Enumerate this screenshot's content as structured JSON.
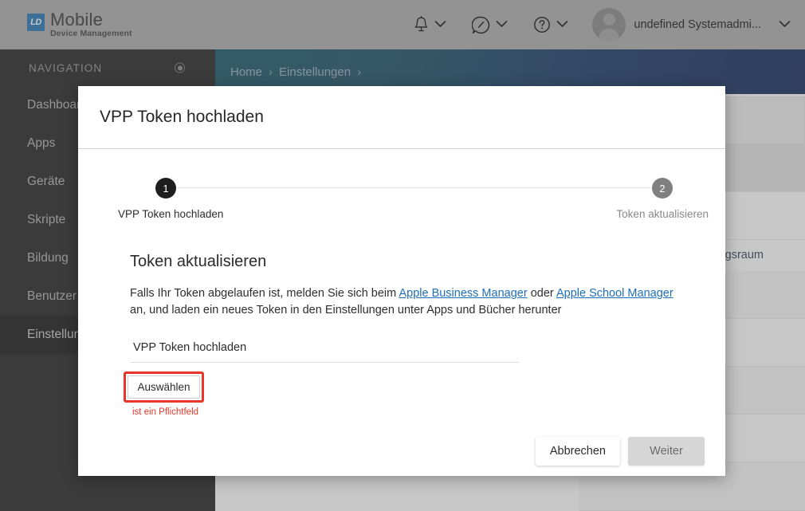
{
  "header": {
    "logo": {
      "badge": "LD",
      "title": "Mobile",
      "subtitle": "Device Management"
    },
    "notifications_icon": "bell-icon",
    "notifications_caret": "chevron-down-icon",
    "compass_icon": "compass-icon",
    "compass_caret": "chevron-down-icon",
    "help_icon": "question-circle-icon",
    "help_caret": "chevron-down-icon",
    "avatar_icon": "avatar-icon",
    "user_name": "undefined Systemadmi...",
    "user_caret": "chevron-down-icon"
  },
  "sidebar": {
    "section_label": "NAVIGATION",
    "pin_icon": "circle-dot-icon",
    "items": [
      {
        "label": "Dashboard",
        "active": false
      },
      {
        "label": "Apps",
        "active": false
      },
      {
        "label": "Geräte",
        "active": false
      },
      {
        "label": "Skripte",
        "active": false
      },
      {
        "label": "Bildung",
        "active": false
      },
      {
        "label": "Benutzer",
        "active": false
      },
      {
        "label": "Einstellungen",
        "active": true
      }
    ]
  },
  "breadcrumb": {
    "items": [
      "Home",
      "Einstellungen"
    ],
    "item0": "Home",
    "sep0": "›",
    "item1": "Einstellungen",
    "sep1": "›"
  },
  "background": {
    "refresh_icon": "refresh-icon",
    "partial_row_text": "gsraum"
  },
  "modal": {
    "title": "VPP Token hochladen",
    "stepper": {
      "step1_number": "1",
      "step1_label": "VPP Token hochladen",
      "step2_number": "2",
      "step2_label": "Token aktualisieren"
    },
    "section_title": "Token aktualisieren",
    "description": {
      "part1": "Falls Ihr Token abgelaufen ist, melden Sie sich beim ",
      "link1": "Apple Business Manager",
      "part2": " oder ",
      "link2": "Apple School Manager",
      "part3": " an, und laden ein neues Token in den Einstellungen unter Apps und Bücher herunter"
    },
    "file_field": {
      "placeholder": "VPP Token hochladen",
      "value": ""
    },
    "choose_button": "Auswählen",
    "error_text": "ist ein Pflichtfeld",
    "highlight_color": "#e8372a",
    "footer": {
      "cancel": "Abbrechen",
      "next": "Weiter"
    }
  }
}
